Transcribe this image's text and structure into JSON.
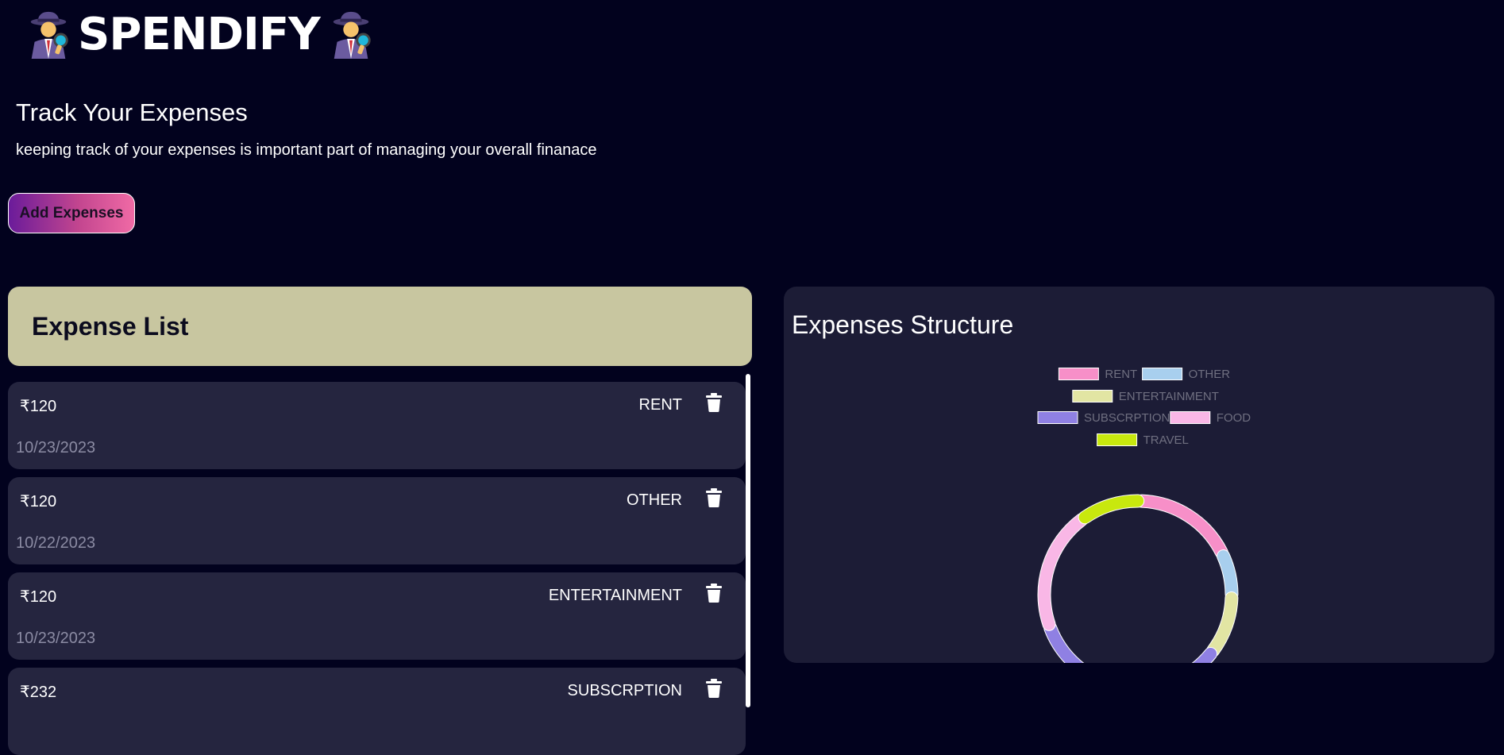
{
  "brand": {
    "name": "SPENDIFY"
  },
  "intro": {
    "title": "Track Your Expenses",
    "subtitle": "keeping track of your expenses is important part of managing your overall finanace"
  },
  "add_button_label": "Add Expenses",
  "expense_list": {
    "title": "Expense List",
    "items": [
      {
        "amount": "₹120",
        "category": "RENT",
        "date": "10/23/2023"
      },
      {
        "amount": "₹120",
        "category": "OTHER",
        "date": "10/22/2023"
      },
      {
        "amount": "₹120",
        "category": "ENTERTAINMENT",
        "date": "10/23/2023"
      },
      {
        "amount": "₹232",
        "category": "SUBSCRPTION",
        "date": ""
      }
    ]
  },
  "chart_panel": {
    "title": "Expenses Structure"
  },
  "chart_data": {
    "type": "pie",
    "legend_position": "top",
    "categories": [
      "RENT",
      "OTHER",
      "ENTERTAINMENT",
      "SUBSCRPTION",
      "FOOD",
      "TRAVEL"
    ],
    "values": [
      120,
      50,
      70,
      232,
      140,
      70
    ],
    "colors": [
      "#f78fc8",
      "#a8cfee",
      "#e2e5a3",
      "#8f80e3",
      "#f9b7e6",
      "#c8e80e"
    ]
  },
  "colors": {
    "background": "#02021e",
    "card": "#25253f",
    "list_header": "#c8c6a0",
    "chart_panel": "#1c1c36",
    "date_text": "#8b8ba3",
    "legend_text": "#6f6f80"
  },
  "icons": {
    "logo_left": "detective-icon",
    "logo_right": "detective-icon",
    "delete": "trash-icon"
  }
}
